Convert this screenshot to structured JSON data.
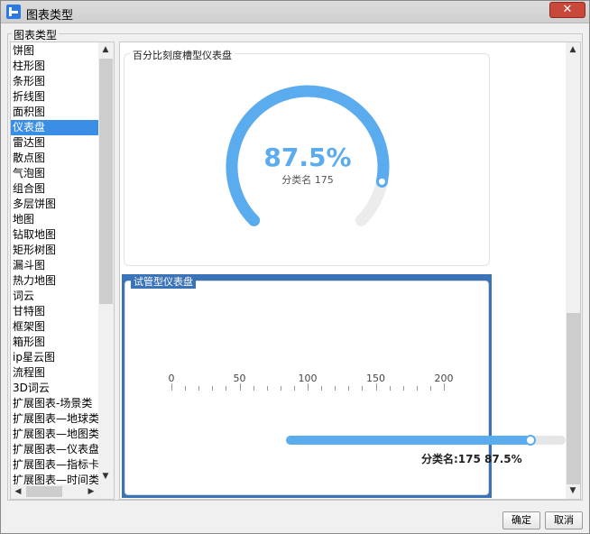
{
  "window": {
    "title": "图表类型",
    "close_label": "✕"
  },
  "group_label": "图表类型",
  "chart_types": [
    "饼图",
    "柱形图",
    "条形图",
    "折线图",
    "面积图",
    "仪表盘",
    "雷达图",
    "散点图",
    "气泡图",
    "组合图",
    "多层饼图",
    "地图",
    "钻取地图",
    "矩形树图",
    "漏斗图",
    "热力地图",
    "词云",
    "甘特图",
    "框架图",
    "箱形图",
    "ip星云图",
    "流程图",
    "3D词云",
    "扩展图表-场景类",
    "扩展图表—地球类",
    "扩展图表—地图类",
    "扩展图表—仪表盘类",
    "扩展图表—指标卡类",
    "扩展图表—时间类"
  ],
  "selected_index": 5,
  "preview": {
    "card1_title": "百分比刻度槽型仪表盘",
    "card1_value": "87.5%",
    "card1_sub": "分类名 175",
    "card1_percent": 87.5,
    "card2_title": "试管型仪表盘",
    "card2_ticks": [
      "0",
      "50",
      "100",
      "150",
      "200"
    ],
    "card2_max": 200,
    "card2_value": 175,
    "card2_caption": "分类名:175 87.5%"
  },
  "colors": {
    "accent": "#5aacef",
    "selection": "#3a8ee6",
    "track": "#e6e6e6",
    "frame": "#3a73b8"
  },
  "buttons": {
    "ok": "确定",
    "cancel": "取消"
  }
}
